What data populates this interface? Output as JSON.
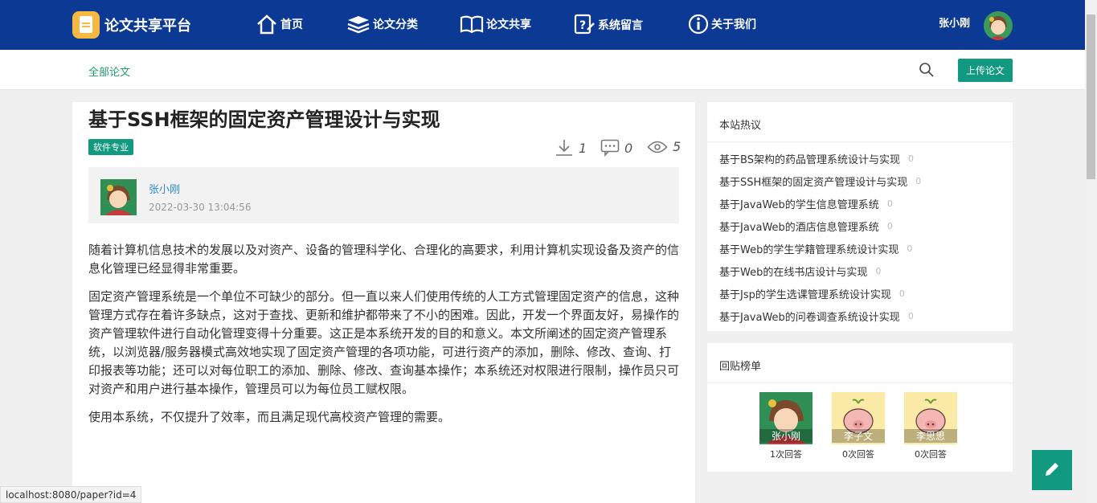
{
  "app": {
    "name": "论文共享平台",
    "user": "张小刚"
  },
  "nav": {
    "items": [
      {
        "label": "首页",
        "icon": "home-icon"
      },
      {
        "label": "论文分类",
        "icon": "layers-icon"
      },
      {
        "label": "论文共享",
        "icon": "book-icon"
      },
      {
        "label": "系统留言",
        "icon": "message-icon"
      },
      {
        "label": "关于我们",
        "icon": "info-icon"
      }
    ]
  },
  "subbar": {
    "breadcrumb": "全部论文",
    "upload_label": "上传论文",
    "search_icon": "search-icon"
  },
  "paper": {
    "title": "基于SSH框架的固定资产管理设计与实现",
    "tag": "软件专业",
    "downloads": "1",
    "comments": "0",
    "views": "5",
    "author": "张小刚",
    "date": "2022-03-30 13:04:56",
    "paragraphs": [
      "随着计算机信息技术的发展以及对资产、设备的管理科学化、合理化的高要求，利用计算机实现设备及资产的信息化管理已经显得非常重要。",
      "固定资产管理系统是一个单位不可缺少的部分。但一直以来人们使用传统的人工方式管理固定资产的信息，这种管理方式存在着许多缺点，这对于查找、更新和维护都带来了不小的困难。因此，开发一个界面友好，易操作的资产管理软件进行自动化管理变得十分重要。这正是本系统开发的目的和意义。本文所阐述的固定资产管理系统，以浏览器/服务器模式高效地实现了固定资产管理的各项功能，可进行资产的添加，删除、修改、查询、打印报表等功能；还可以对每位职工的添加、删除、修改、查询基本操作；本系统还对权限进行限制，操作员只可对资产和用户进行基本操作，管理员可以为每位员工赋权限。",
      "使用本系统，不仅提升了效率，而且满足现代高校资产管理的需要。"
    ]
  },
  "hot": {
    "title": "本站热议",
    "items": [
      {
        "label": "基于BS架构的药品管理系统设计与实现",
        "count": "0"
      },
      {
        "label": "基于SSH框架的固定资产管理设计与实现",
        "count": "0"
      },
      {
        "label": "基于JavaWeb的学生信息管理系统",
        "count": "0"
      },
      {
        "label": "基于JavaWeb的酒店信息管理系统",
        "count": "0"
      },
      {
        "label": "基于Web的学生学籍管理系统设计实现",
        "count": "0"
      },
      {
        "label": "基于Web的在线书店设计与实现",
        "count": "0"
      },
      {
        "label": "基于Jsp的学生选课管理系统设计实现",
        "count": "0"
      },
      {
        "label": "基于JavaWeb的问卷调查系统设计实现",
        "count": "0"
      }
    ]
  },
  "ranking": {
    "title": "回贴榜单",
    "users": [
      {
        "name": "张小刚",
        "count": "1次回答"
      },
      {
        "name": "李子文",
        "count": "0次回答"
      },
      {
        "name": "李思思",
        "count": "0次回答"
      }
    ]
  },
  "status_url": "localhost:8080/paper?id=4",
  "colors": {
    "nav": "#0b3994",
    "accent": "#119a80",
    "link": "#2a8ad4"
  }
}
